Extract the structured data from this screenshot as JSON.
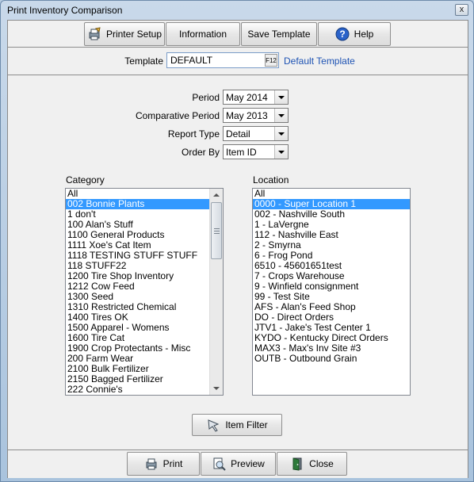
{
  "window": {
    "title": "Print Inventory Comparison",
    "close_glyph": "x"
  },
  "toolbar": {
    "printer_setup": "Printer Setup",
    "information": "Information",
    "save_template": "Save Template",
    "help": "Help"
  },
  "template": {
    "label": "Template",
    "value": "DEFAULT",
    "lookup_glyph": "F12",
    "description": "Default Template"
  },
  "form": {
    "period": {
      "label": "Period",
      "value": "May 2014"
    },
    "comparative_period": {
      "label": "Comparative Period",
      "value": "May 2013"
    },
    "report_type": {
      "label": "Report Type",
      "value": "Detail"
    },
    "order_by": {
      "label": "Order By",
      "value": "Item ID"
    }
  },
  "category": {
    "label": "Category",
    "selected_index": 1,
    "items": [
      "All",
      "002 Bonnie Plants",
      "1 don't",
      "100 Alan's Stuff",
      "1100 General Products",
      "1111 Xoe's Cat Item",
      "1118 TESTING STUFF STUFF",
      "118 STUFF22",
      "1200 Tire Shop Inventory",
      "1212 Cow Feed",
      "1300 Seed",
      "1310 Restricted Chemical",
      "1400 Tires OK",
      "1500 Apparel - Womens",
      "1600 Tire Cat",
      "1900 Crop Protectants - Misc",
      "200 Farm Wear",
      "2100 Bulk Fertilizer",
      "2150 Bagged Fertilizer",
      "222 Connie's"
    ]
  },
  "location": {
    "label": "Location",
    "selected_index": 1,
    "items": [
      "All",
      "0000 - Super Location 1",
      "002 - Nashville South",
      "1 - LaVergne",
      "112 - Nashville East",
      "2 - Smyrna",
      "6 - Frog Pond",
      "6510 - 45601651test",
      "7 - Crops Warehouse",
      "9 - Winfield consignment",
      "99 - Test Site",
      "AFS - Alan's Feed Shop",
      "DO - Direct Orders",
      "JTV1 - Jake's Test Center 1",
      "KYDO - Kentucky Direct Orders",
      "MAX3 - Max's Inv Site #3",
      "OUTB - Outbound Grain"
    ]
  },
  "item_filter": "Item Filter",
  "footer": {
    "print": "Print",
    "preview": "Preview",
    "close": "Close"
  },
  "icons": {
    "printer_setup": "printer-setup-icon",
    "help": "help-icon",
    "item_filter": "funnel-icon",
    "print": "printer-icon",
    "preview": "preview-icon",
    "close": "close-door-icon"
  },
  "colors": {
    "selection": "#3399ff",
    "window_frame": "#b8cde2",
    "client": "#f0f0f0"
  }
}
